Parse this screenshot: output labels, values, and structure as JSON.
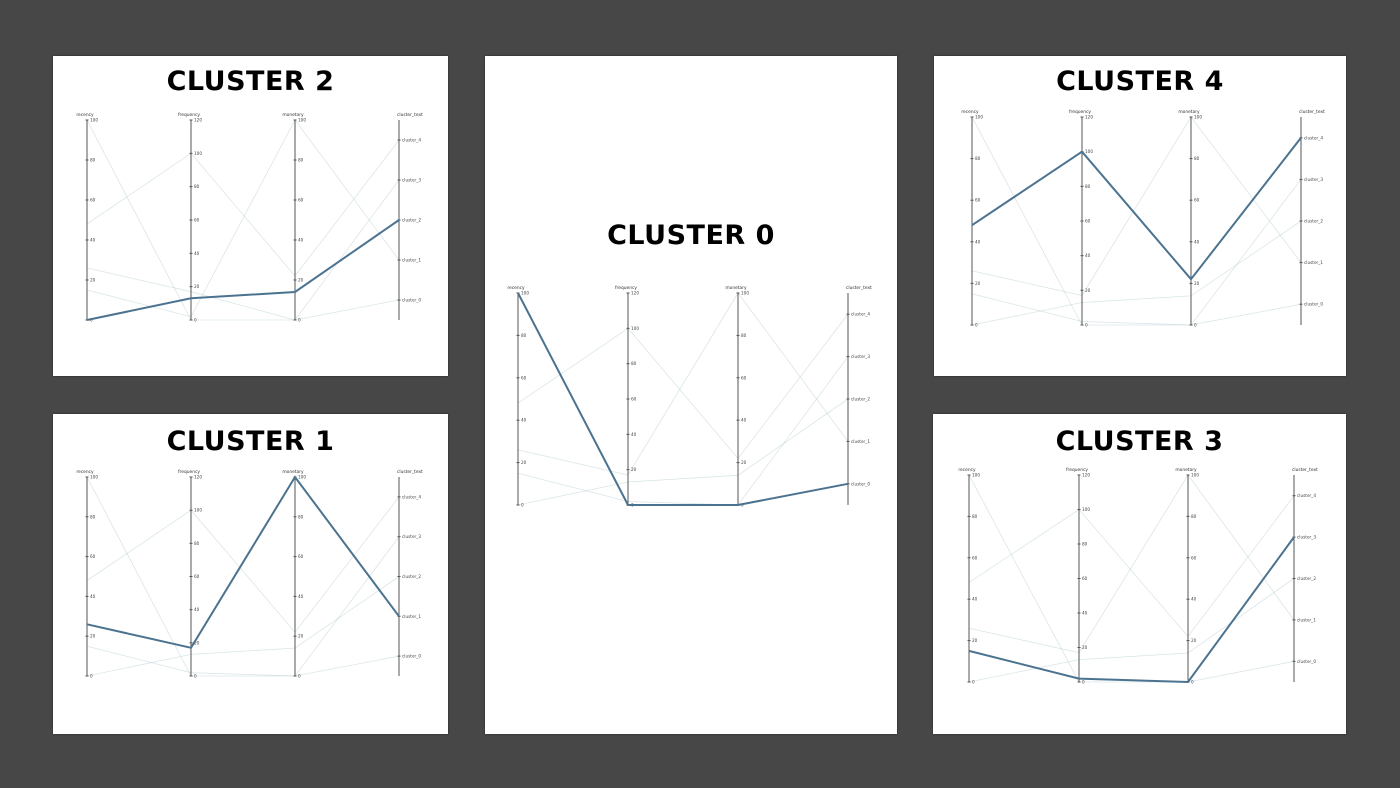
{
  "colors": {
    "background": "#474747",
    "panel": "#ffffff",
    "highlight": "#4b7390",
    "context": "#aec8cc"
  },
  "chart_data": [
    {
      "id": "cluster2",
      "type": "parallel-coordinates",
      "title": "CLUSTER 2",
      "axes": [
        {
          "name": "recency",
          "min": 0,
          "max": 100,
          "ticks": [
            "0",
            "20",
            "40",
            "60",
            "80",
            "100"
          ]
        },
        {
          "name": "frequency",
          "min": 0,
          "max": 120,
          "ticks": [
            "0",
            "20",
            "40",
            "60",
            "80",
            "100",
            "120"
          ]
        },
        {
          "name": "monetary",
          "min": 0,
          "max": 100,
          "ticks": [
            "0",
            "20",
            "40",
            "60",
            "80",
            "100"
          ]
        },
        {
          "name": "cluster_text",
          "categories": [
            "cluster_0",
            "cluster_1",
            "cluster_2",
            "cluster_3",
            "cluster_4"
          ]
        }
      ],
      "highlight": {
        "recency": 0,
        "frequency": 13,
        "monetary": 14,
        "cluster_text": "cluster_2"
      },
      "context": [
        {
          "recency": 26,
          "frequency": 17,
          "monetary": 0,
          "cluster_text": "cluster_3"
        },
        {
          "recency": 100,
          "frequency": 0,
          "monetary": 0,
          "cluster_text": "cluster_0"
        },
        {
          "recency": 48,
          "frequency": 100,
          "monetary": 22,
          "cluster_text": "cluster_4"
        },
        {
          "recency": 15,
          "frequency": 2,
          "monetary": 100,
          "cluster_text": "cluster_1"
        }
      ]
    },
    {
      "id": "cluster1",
      "type": "parallel-coordinates",
      "title": "CLUSTER 1",
      "axes": [
        {
          "name": "recency",
          "min": 0,
          "max": 100,
          "ticks": [
            "0",
            "20",
            "40",
            "60",
            "80",
            "100"
          ]
        },
        {
          "name": "frequency",
          "min": 0,
          "max": 120,
          "ticks": [
            "0",
            "20",
            "40",
            "60",
            "80",
            "100",
            "120"
          ]
        },
        {
          "name": "monetary",
          "min": 0,
          "max": 100,
          "ticks": [
            "0",
            "20",
            "40",
            "60",
            "80",
            "100"
          ]
        },
        {
          "name": "cluster_text",
          "categories": [
            "cluster_0",
            "cluster_1",
            "cluster_2",
            "cluster_3",
            "cluster_4"
          ]
        }
      ],
      "highlight": {
        "recency": 26,
        "frequency": 17,
        "monetary": 100,
        "cluster_text": "cluster_1"
      },
      "context": [
        {
          "recency": 0,
          "frequency": 13,
          "monetary": 14,
          "cluster_text": "cluster_2"
        },
        {
          "recency": 100,
          "frequency": 0,
          "monetary": 0,
          "cluster_text": "cluster_0"
        },
        {
          "recency": 48,
          "frequency": 100,
          "monetary": 22,
          "cluster_text": "cluster_4"
        },
        {
          "recency": 15,
          "frequency": 2,
          "monetary": 0,
          "cluster_text": "cluster_3"
        }
      ]
    },
    {
      "id": "cluster0",
      "type": "parallel-coordinates",
      "title": "CLUSTER 0",
      "axes": [
        {
          "name": "recency",
          "min": 0,
          "max": 100,
          "ticks": [
            "0",
            "20",
            "40",
            "60",
            "80",
            "100"
          ]
        },
        {
          "name": "frequency",
          "min": 0,
          "max": 120,
          "ticks": [
            "0",
            "20",
            "40",
            "60",
            "80",
            "100",
            "120"
          ]
        },
        {
          "name": "monetary",
          "min": 0,
          "max": 100,
          "ticks": [
            "0",
            "20",
            "40",
            "60",
            "80",
            "100"
          ]
        },
        {
          "name": "cluster_text",
          "categories": [
            "cluster_0",
            "cluster_1",
            "cluster_2",
            "cluster_3",
            "cluster_4"
          ]
        }
      ],
      "highlight": {
        "recency": 100,
        "frequency": 0,
        "monetary": 0,
        "cluster_text": "cluster_0"
      },
      "context": [
        {
          "recency": 0,
          "frequency": 13,
          "monetary": 14,
          "cluster_text": "cluster_2"
        },
        {
          "recency": 26,
          "frequency": 17,
          "monetary": 100,
          "cluster_text": "cluster_1"
        },
        {
          "recency": 48,
          "frequency": 100,
          "monetary": 22,
          "cluster_text": "cluster_4"
        },
        {
          "recency": 15,
          "frequency": 2,
          "monetary": 0,
          "cluster_text": "cluster_3"
        }
      ]
    },
    {
      "id": "cluster4",
      "type": "parallel-coordinates",
      "title": "CLUSTER 4",
      "axes": [
        {
          "name": "recency",
          "min": 0,
          "max": 100,
          "ticks": [
            "0",
            "20",
            "40",
            "60",
            "80",
            "100"
          ]
        },
        {
          "name": "frequency",
          "min": 0,
          "max": 120,
          "ticks": [
            "0",
            "20",
            "40",
            "60",
            "80",
            "100",
            "120"
          ]
        },
        {
          "name": "monetary",
          "min": 0,
          "max": 100,
          "ticks": [
            "0",
            "20",
            "40",
            "60",
            "80",
            "100"
          ]
        },
        {
          "name": "cluster_text",
          "categories": [
            "cluster_0",
            "cluster_1",
            "cluster_2",
            "cluster_3",
            "cluster_4"
          ]
        }
      ],
      "highlight": {
        "recency": 48,
        "frequency": 100,
        "monetary": 22,
        "cluster_text": "cluster_4"
      },
      "context": [
        {
          "recency": 0,
          "frequency": 13,
          "monetary": 14,
          "cluster_text": "cluster_2"
        },
        {
          "recency": 26,
          "frequency": 17,
          "monetary": 100,
          "cluster_text": "cluster_1"
        },
        {
          "recency": 100,
          "frequency": 0,
          "monetary": 0,
          "cluster_text": "cluster_0"
        },
        {
          "recency": 15,
          "frequency": 2,
          "monetary": 0,
          "cluster_text": "cluster_3"
        }
      ]
    },
    {
      "id": "cluster3",
      "type": "parallel-coordinates",
      "title": "CLUSTER 3",
      "axes": [
        {
          "name": "recency",
          "min": 0,
          "max": 100,
          "ticks": [
            "0",
            "20",
            "40",
            "60",
            "80",
            "100"
          ]
        },
        {
          "name": "frequency",
          "min": 0,
          "max": 120,
          "ticks": [
            "0",
            "20",
            "40",
            "60",
            "80",
            "100",
            "120"
          ]
        },
        {
          "name": "monetary",
          "min": 0,
          "max": 100,
          "ticks": [
            "0",
            "20",
            "40",
            "60",
            "80",
            "100"
          ]
        },
        {
          "name": "cluster_text",
          "categories": [
            "cluster_0",
            "cluster_1",
            "cluster_2",
            "cluster_3",
            "cluster_4"
          ]
        }
      ],
      "highlight": {
        "recency": 15,
        "frequency": 2,
        "monetary": 0,
        "cluster_text": "cluster_3"
      },
      "context": [
        {
          "recency": 0,
          "frequency": 13,
          "monetary": 14,
          "cluster_text": "cluster_2"
        },
        {
          "recency": 26,
          "frequency": 17,
          "monetary": 100,
          "cluster_text": "cluster_1"
        },
        {
          "recency": 100,
          "frequency": 0,
          "monetary": 0,
          "cluster_text": "cluster_0"
        },
        {
          "recency": 48,
          "frequency": 100,
          "monetary": 22,
          "cluster_text": "cluster_4"
        }
      ]
    }
  ]
}
